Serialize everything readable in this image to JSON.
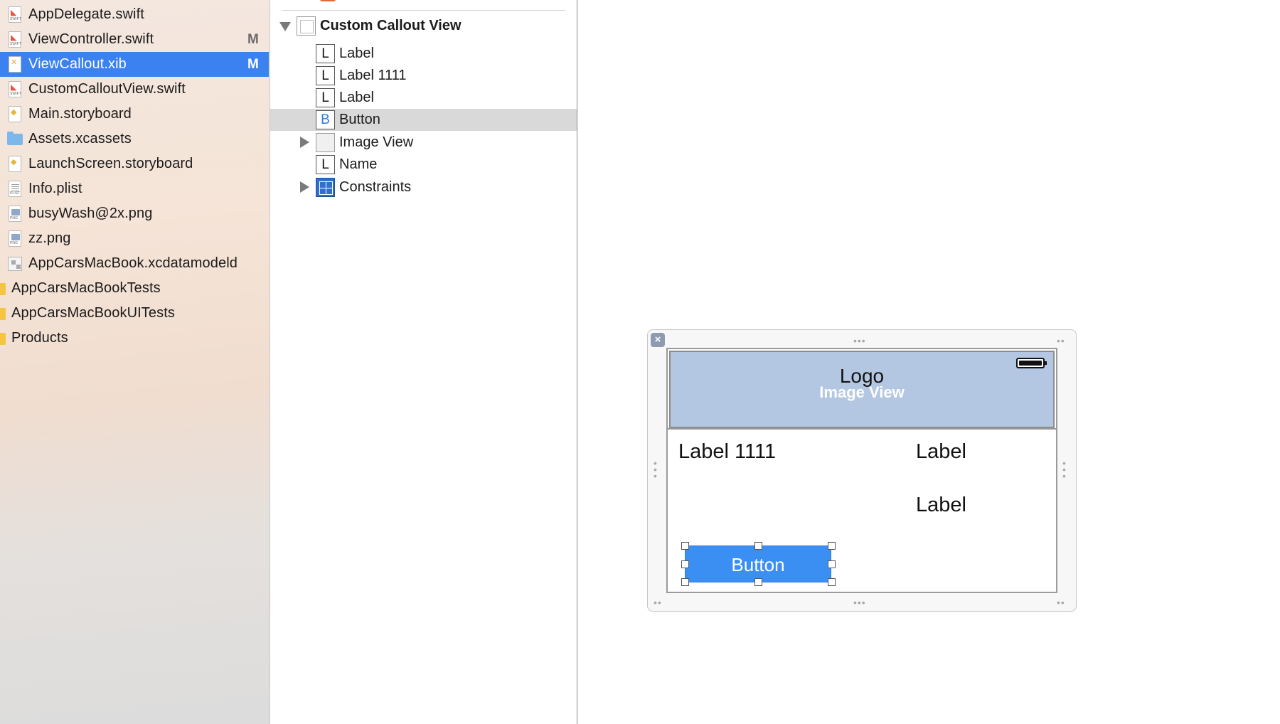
{
  "navigator": {
    "items": [
      {
        "label": "AppDelegate.swift",
        "icon": "swift-file-icon",
        "badge": ""
      },
      {
        "label": "ViewController.swift",
        "icon": "swift-file-icon",
        "badge": "M"
      },
      {
        "label": "ViewCallout.xib",
        "icon": "xib-file-icon",
        "badge": "M",
        "selected": true
      },
      {
        "label": "CustomCalloutView.swift",
        "icon": "swift-file-icon",
        "badge": ""
      },
      {
        "label": "Main.storyboard",
        "icon": "storyboard-file-icon",
        "badge": ""
      },
      {
        "label": "Assets.xcassets",
        "icon": "asset-catalog-icon",
        "badge": ""
      },
      {
        "label": "LaunchScreen.storyboard",
        "icon": "storyboard-file-icon",
        "badge": ""
      },
      {
        "label": "Info.plist",
        "icon": "plist-file-icon",
        "badge": ""
      },
      {
        "label": "busyWash@2x.png",
        "icon": "png-file-icon",
        "badge": ""
      },
      {
        "label": "zz.png",
        "icon": "png-file-icon",
        "badge": ""
      },
      {
        "label": "AppCarsMacBook.xcdatamodeld",
        "icon": "data-model-icon",
        "badge": ""
      },
      {
        "label": "AppCarsMacBookTests",
        "icon": "folder-icon",
        "badge": "",
        "group": true
      },
      {
        "label": "AppCarsMacBookUITests",
        "icon": "folder-icon",
        "badge": "",
        "group": true
      },
      {
        "label": "Products",
        "icon": "folder-icon",
        "badge": "",
        "group": true
      }
    ],
    "selected_color": "#3b82f0"
  },
  "outline": {
    "root": {
      "label": "Custom Callout View",
      "expanded": true
    },
    "items": [
      {
        "glyph": "L",
        "label": "Label"
      },
      {
        "glyph": "L",
        "label": "Label 1111"
      },
      {
        "glyph": "L",
        "label": "Label"
      },
      {
        "glyph": "B",
        "label": "Button",
        "highlighted": true
      },
      {
        "glyph": "",
        "label": "Image View",
        "collapsed": true
      },
      {
        "glyph": "L",
        "label": "Name"
      },
      {
        "glyph": "",
        "label": "Constraints",
        "collapsed": true
      }
    ]
  },
  "canvas": {
    "image_view": {
      "logo_text": "Logo",
      "placeholder_text": "Image View",
      "fill_color": "#b4c7e2"
    },
    "labels": {
      "left_top": "Label 1111",
      "right_top": "Label",
      "right_bottom": "Label"
    },
    "button": {
      "title": "Button",
      "color": "#3c8ff2"
    }
  }
}
